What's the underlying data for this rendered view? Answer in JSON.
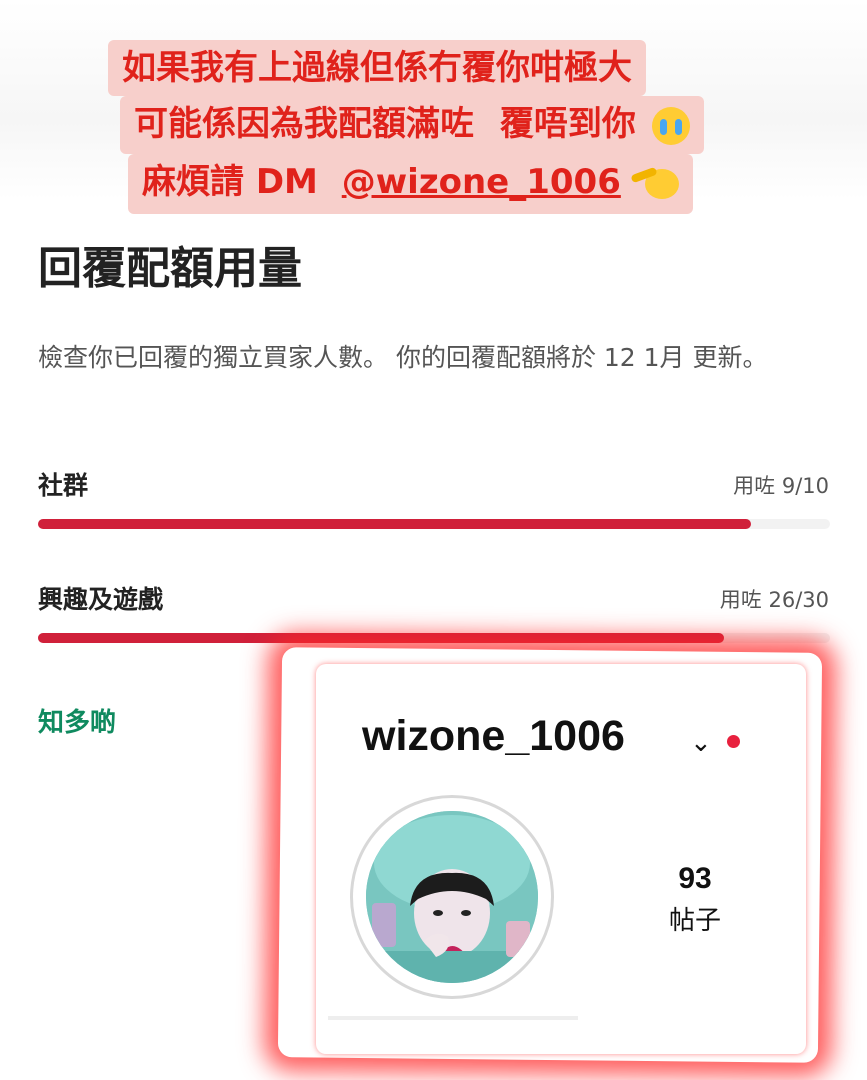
{
  "banner": {
    "line1": "如果我有上過線但係冇覆你咁極大",
    "line2": "可能係因為我配額滿咗",
    "line2_extra": "覆唔到你",
    "line3_prefix": "麻煩請 DM",
    "line3_handle": "@wizone_1006"
  },
  "page": {
    "title": "回覆配額用量",
    "description": "檢查你已回覆的獨立買家人數。 你的回覆配額將於 12 1月 更新。",
    "learn_more": "知多啲"
  },
  "categories": [
    {
      "label": "社群",
      "usage_text": "用咗 9/10",
      "used": 9,
      "total": 10
    },
    {
      "label": "興趣及遊戲",
      "usage_text": "用咗 26/30",
      "used": 26,
      "total": 30
    }
  ],
  "profile_card": {
    "username": "wizone_1006",
    "posts_count": "93",
    "posts_label": "帖子"
  },
  "colors": {
    "banner_bg": "#f7cfcb",
    "banner_text": "#e0221b",
    "progress_fill": "#d0203a",
    "learn_more": "#0f8a5f",
    "glow": "#ff2828"
  },
  "icons": [
    "crying-face-icon",
    "saluting-face-icon",
    "chevron-down-icon",
    "notification-dot-icon",
    "avatar-image"
  ]
}
